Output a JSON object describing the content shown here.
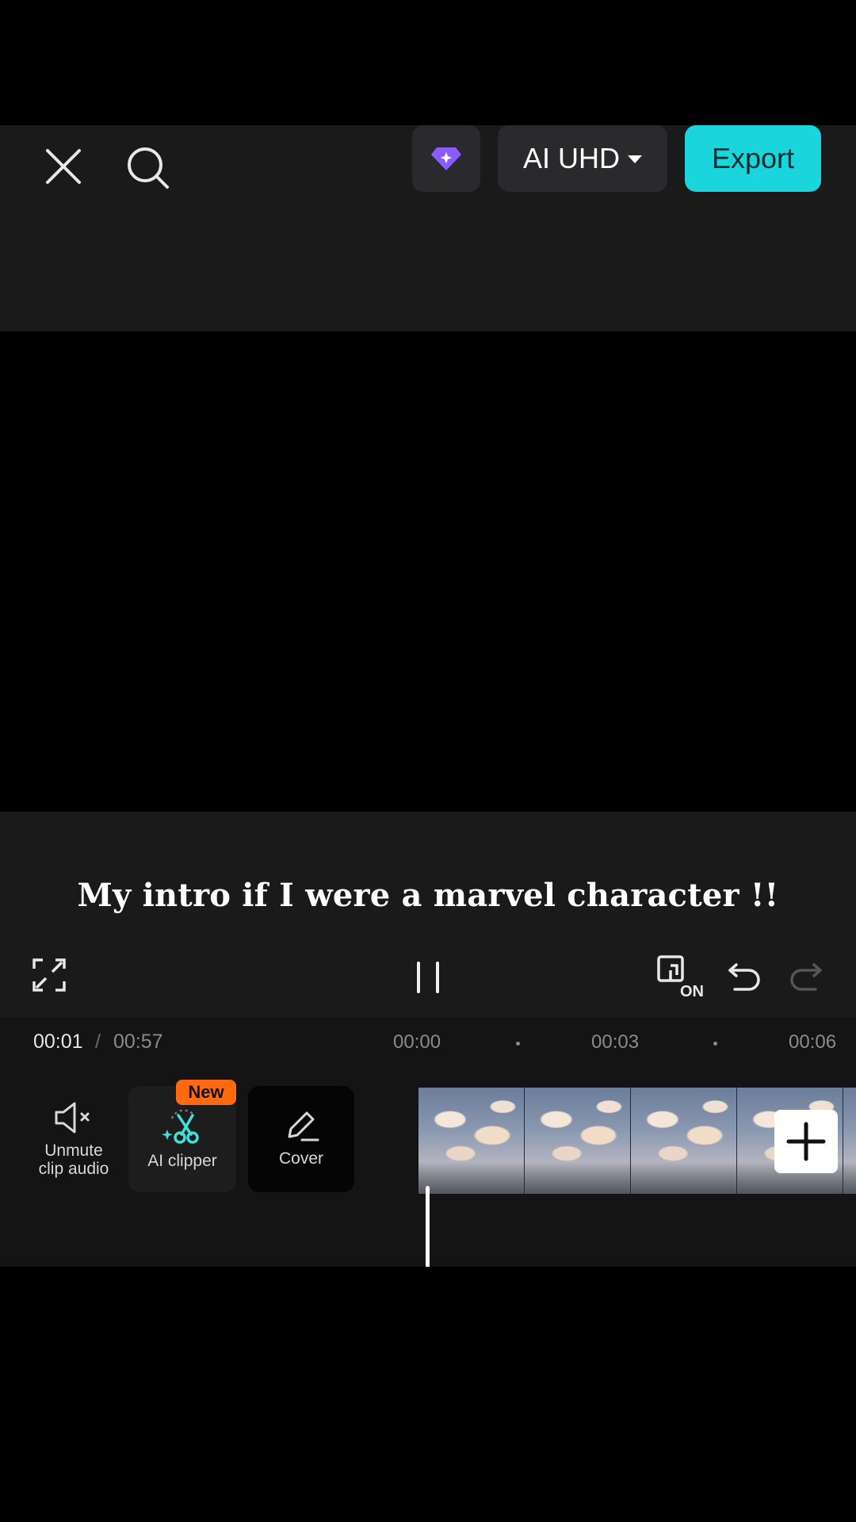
{
  "header": {
    "close_icon": "close-icon",
    "search_icon": "search-icon",
    "pro_icon": "diamond-icon",
    "quality_label": "AI UHD",
    "export_label": "Export",
    "accent_color": "#1bd5dd",
    "pro_color": "#8a5cff"
  },
  "preview": {
    "caption": "My intro if I were a marvel character !!"
  },
  "controls": {
    "fullscreen_icon": "fullscreen-icon",
    "play_state": "pause-icon",
    "main_track_label": "ON",
    "undo_icon": "undo-icon",
    "redo_icon": "redo-icon"
  },
  "timeline": {
    "current_time": "00:01",
    "separator": "/",
    "total_time": "00:57",
    "ticks": [
      "00:00",
      "00:03",
      "00:06"
    ],
    "tools": [
      {
        "icon": "mute-icon",
        "label_line1": "Unmute",
        "label_line2": "clip audio"
      },
      {
        "icon": "ai-scissors-icon",
        "label": "AI clipper",
        "badge": "New"
      },
      {
        "icon": "pencil-icon",
        "label": "Cover"
      }
    ],
    "badge_color": "#ff6a10",
    "add_clip_icon": "plus-icon"
  }
}
